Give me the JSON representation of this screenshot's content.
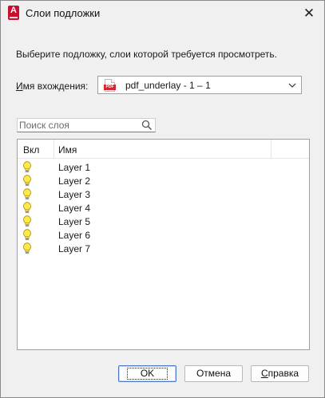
{
  "window": {
    "title": "Слои подложки",
    "close_glyph": "✕"
  },
  "instruction": "Выберите подложку, слои которой требуется просмотреть.",
  "reference": {
    "label_underlined": "И",
    "label_rest": "мя вхождения:",
    "value": "pdf_underlay - 1 – 1",
    "icon": "pdf-file-icon"
  },
  "search": {
    "placeholder": "Поиск слоя",
    "value": ""
  },
  "layer_table": {
    "columns": [
      "Вкл",
      "Имя"
    ],
    "rows": [
      {
        "on": true,
        "name": "Layer 1"
      },
      {
        "on": true,
        "name": "Layer 2"
      },
      {
        "on": true,
        "name": "Layer 3"
      },
      {
        "on": true,
        "name": "Layer 4"
      },
      {
        "on": true,
        "name": "Layer 5"
      },
      {
        "on": true,
        "name": "Layer 6"
      },
      {
        "on": true,
        "name": "Layer 7"
      }
    ]
  },
  "buttons": {
    "ok": "OK",
    "cancel": "Отмена",
    "help_underlined": "С",
    "help_rest": "правка"
  },
  "colors": {
    "app_icon": "#c8102e",
    "pdf_tag": "#d5232f",
    "bulb_on": "#ffe84a",
    "default_button_border": "#4a78c2"
  }
}
